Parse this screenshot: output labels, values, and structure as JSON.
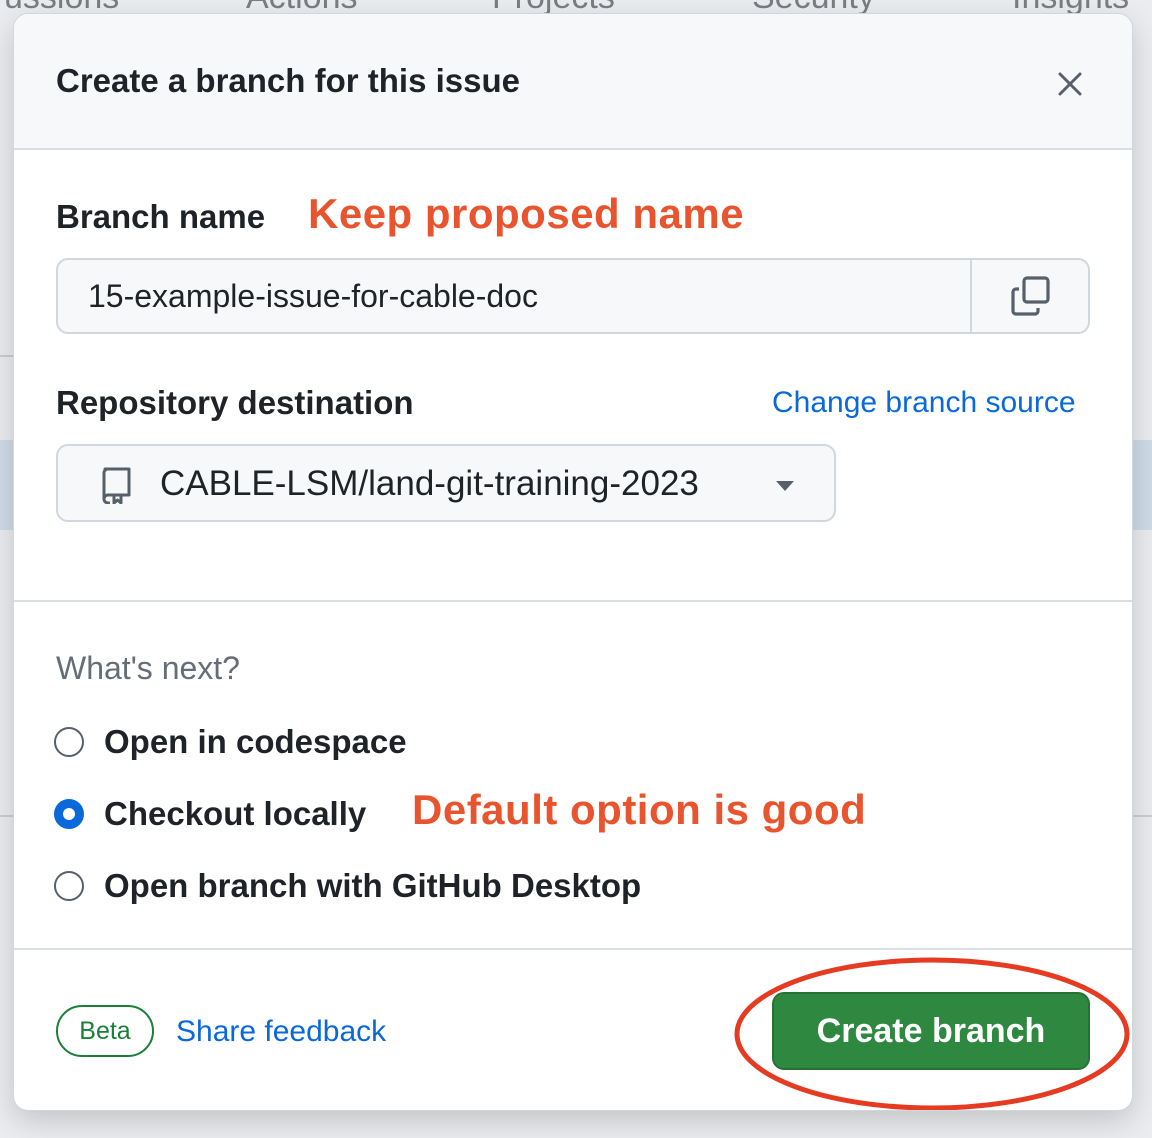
{
  "background": {
    "nav_fragments": [
      "ussions",
      "Actions",
      "Projects",
      "Security",
      "Insights"
    ]
  },
  "modal": {
    "title": "Create a branch for this issue",
    "close_icon": "x-icon",
    "branch_name": {
      "label": "Branch name",
      "value": "15-example-issue-for-cable-doc",
      "copy_icon": "copy-icon"
    },
    "repository": {
      "label": "Repository destination",
      "change_source_link": "Change branch source",
      "selected": "CABLE-LSM/land-git-training-2023",
      "repo_icon": "repo-icon",
      "caret_icon": "triangle-down-icon"
    },
    "whats_next": {
      "heading": "What's next?",
      "options": [
        {
          "label": "Open in codespace",
          "checked": false
        },
        {
          "label": "Checkout locally",
          "checked": true
        },
        {
          "label": "Open branch with GitHub Desktop",
          "checked": false
        }
      ]
    },
    "footer": {
      "badge": "Beta",
      "feedback_link": "Share feedback",
      "create_button": "Create branch"
    }
  },
  "annotations": {
    "keep_name": "Keep proposed name",
    "default_option": "Default option is good",
    "color": "#e8542e"
  },
  "colors": {
    "accent_link": "#0969da",
    "primary_button": "#2f883f",
    "beta_badge": "#1a7f37"
  }
}
